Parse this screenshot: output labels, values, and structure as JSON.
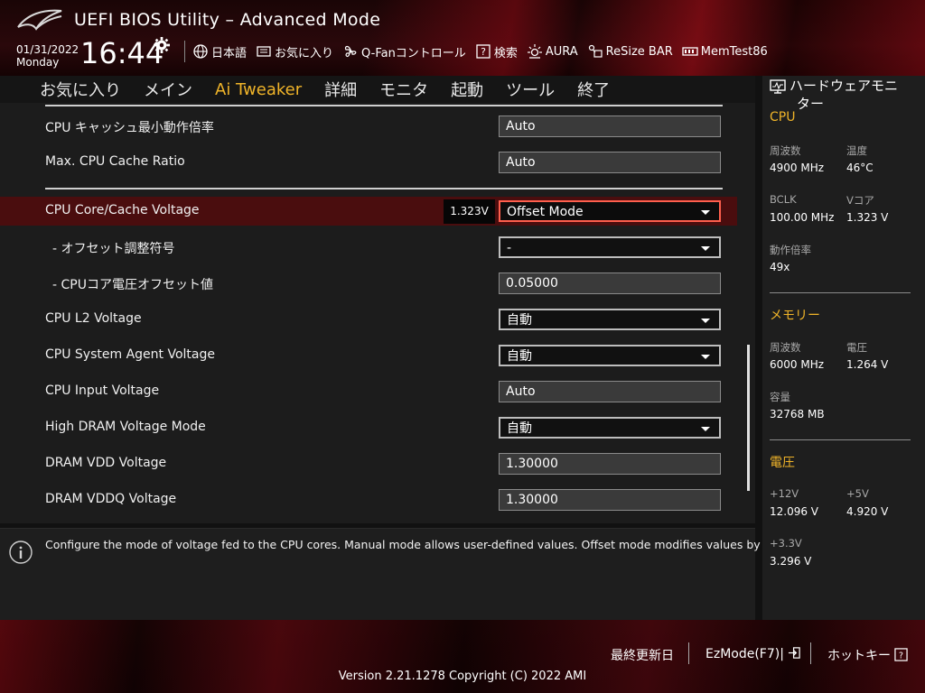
{
  "header": {
    "app_title": "UEFI BIOS Utility – Advanced Mode",
    "date": "01/31/2022",
    "day": "Monday",
    "time": "16:44",
    "tools": [
      {
        "label": "日本語",
        "icon": "globe-icon"
      },
      {
        "label": "お気に入り",
        "icon": "favorites-icon"
      },
      {
        "label": "Q-Fanコントロール",
        "icon": "fan-icon"
      },
      {
        "label": "検索",
        "icon": "search-help-icon"
      },
      {
        "label": "AURA",
        "icon": "aura-light-icon"
      },
      {
        "label": "ReSize BAR",
        "icon": "resize-bar-icon"
      },
      {
        "label": "MemTest86",
        "icon": "memory-icon"
      }
    ]
  },
  "nav": {
    "tabs": [
      "お気に入り",
      "メイン",
      "Ai Tweaker",
      "詳細",
      "モニタ",
      "起動",
      "ツール",
      "終了"
    ],
    "active": "Ai Tweaker"
  },
  "settings": {
    "rows": [
      {
        "label": "CPU キャッシュ最小動作倍率",
        "value": "Auto",
        "type": "field"
      },
      {
        "label": "Max. CPU Cache Ratio",
        "value": "Auto",
        "type": "field"
      },
      {
        "label": "CPU Core/Cache Voltage",
        "value": "Offset Mode",
        "type": "select",
        "badge": "1.323V"
      },
      {
        "label": "- オフセット調整符号",
        "value": "-",
        "type": "select"
      },
      {
        "label": "- CPUコア電圧オフセット値",
        "value": "0.05000",
        "type": "field"
      },
      {
        "label": "CPU L2 Voltage",
        "value": "自動",
        "type": "select"
      },
      {
        "label": "CPU System Agent Voltage",
        "value": "自動",
        "type": "select"
      },
      {
        "label": "CPU Input Voltage",
        "value": "Auto",
        "type": "field"
      },
      {
        "label": "High DRAM Voltage Mode",
        "value": "自動",
        "type": "select"
      },
      {
        "label": "DRAM VDD Voltage",
        "value": "1.30000",
        "type": "field"
      },
      {
        "label": "DRAM VDDQ Voltage",
        "value": "1.30000",
        "type": "field"
      }
    ]
  },
  "help": {
    "text": "Configure the mode of voltage fed to the CPU cores. Manual mode allows user-defined values. Offset mode modifies values by SVID."
  },
  "monitor": {
    "title_line1": "ハードウェアモニ",
    "title_line2": "ター",
    "cpu": {
      "heading": "CPU",
      "freq_label": "周波数",
      "freq": "4900 MHz",
      "temp_label": "温度",
      "temp": "46°C",
      "bclk_label": "BCLK",
      "bclk": "100.00 MHz",
      "vcore_label": "Vコア",
      "vcore": "1.323 V",
      "ratio_label": "動作倍率",
      "ratio": "49x"
    },
    "memory": {
      "heading": "メモリー",
      "freq_label": "周波数",
      "freq": "6000 MHz",
      "volt_label": "電圧",
      "volt": "1.264 V",
      "cap_label": "容量",
      "cap": "32768 MB"
    },
    "voltage": {
      "heading": "電圧",
      "v12_label": "+12V",
      "v12": "12.096 V",
      "v5_label": "+5V",
      "v5": "4.920 V",
      "v33_label": "+3.3V",
      "v33": "3.296 V"
    }
  },
  "footer": {
    "last_modified": "最終更新日",
    "ezmode": "EzMode(F7)|",
    "hotkeys": "ホットキー",
    "version": "Version 2.21.1278 Copyright (C) 2022 AMI"
  },
  "colors": {
    "accent": "#f0b429",
    "highlight_row": "#4a0d0e",
    "select_focus_border": "#ff5f4d"
  }
}
